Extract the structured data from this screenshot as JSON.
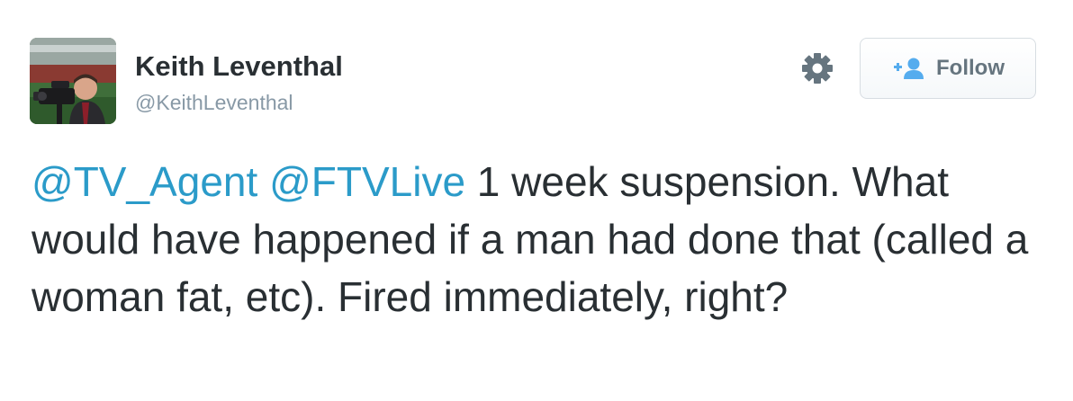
{
  "author": {
    "display_name": "Keith Leventhal",
    "handle": "@KeithLeventhal"
  },
  "actions": {
    "settings_icon": "gear-icon",
    "follow_icon": "add-user-icon",
    "follow_label": "Follow"
  },
  "tweet": {
    "mention_1": "@TV_Agent",
    "mention_2": "@FTVLive",
    "text": " 1 week suspension. What would have happened if a man had done that (called a woman fat, etc). Fired immediately, right?"
  },
  "colors": {
    "mention": "#2b9bc9",
    "follow_icon": "#55acee",
    "secondary_text": "#8899a6"
  }
}
